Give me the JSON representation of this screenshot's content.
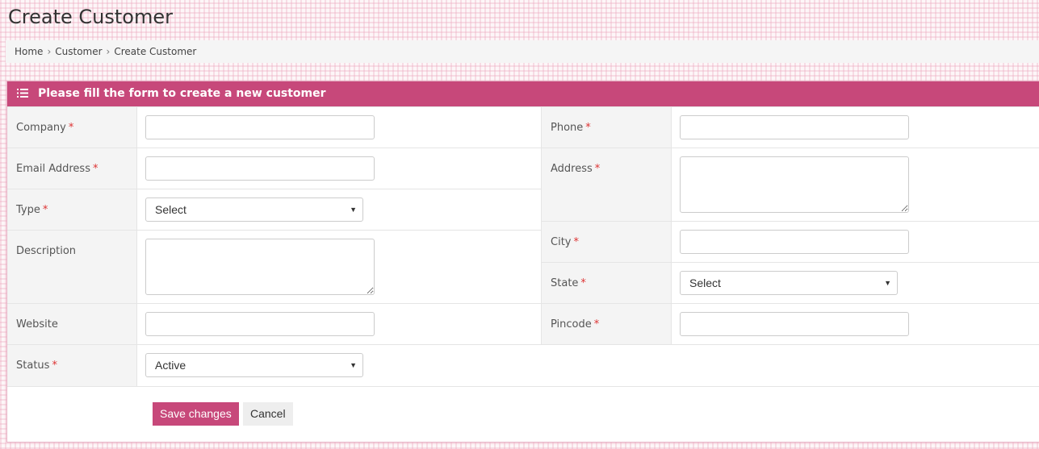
{
  "page": {
    "title": "Create Customer"
  },
  "breadcrumb": {
    "items": [
      "Home",
      "Customer",
      "Create Customer"
    ],
    "separator": "›"
  },
  "panel": {
    "title": "Please fill the form to create a new customer",
    "header_color": "#c7487a"
  },
  "form": {
    "left": {
      "company": {
        "label": "Company",
        "required": "*",
        "value": ""
      },
      "email": {
        "label": "Email Address",
        "required": "*",
        "value": ""
      },
      "type": {
        "label": "Type",
        "required": "*",
        "selected": "Select"
      },
      "description": {
        "label": "Description",
        "value": ""
      },
      "website": {
        "label": "Website",
        "value": ""
      },
      "status": {
        "label": "Status",
        "required": "*",
        "selected": "Active"
      }
    },
    "right": {
      "phone": {
        "label": "Phone",
        "required": "*",
        "value": ""
      },
      "address": {
        "label": "Address",
        "required": "*",
        "value": ""
      },
      "city": {
        "label": "City",
        "required": "*",
        "value": ""
      },
      "state": {
        "label": "State",
        "required": "*",
        "selected": "Select"
      },
      "pincode": {
        "label": "Pincode",
        "required": "*",
        "value": ""
      }
    }
  },
  "actions": {
    "save_label": "Save changes",
    "cancel_label": "Cancel"
  },
  "icons": {
    "header_icon": "list-icon",
    "select_caret": "caret-down-icon"
  }
}
